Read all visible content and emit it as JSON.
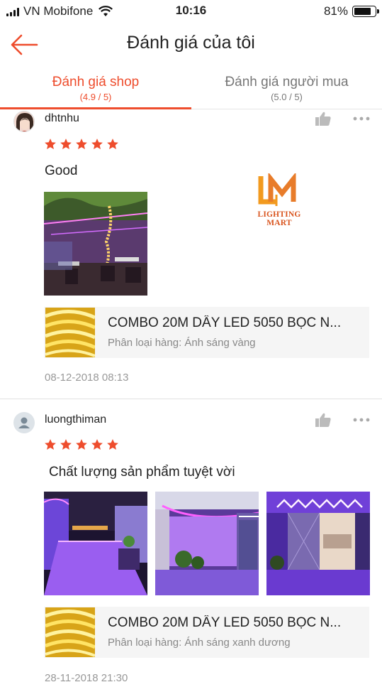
{
  "status_bar": {
    "carrier": "VN Mobifone",
    "time": "10:16",
    "battery": "81%",
    "battery_level": 0.81
  },
  "header": {
    "title": "Đánh giá của tôi",
    "back_icon": "arrow-left-icon"
  },
  "tabs": [
    {
      "label": "Đánh giá shop",
      "rating": "(4.9 / 5)",
      "active": true
    },
    {
      "label": "Đánh giá người mua",
      "rating": "(5.0 / 5)",
      "active": false
    }
  ],
  "colors": {
    "accent": "#ee4d2d",
    "star": "#ee4d2d",
    "muted": "#999999",
    "card_bg": "#f5f5f5"
  },
  "reviews": [
    {
      "username": "dhtnhu",
      "stars": 5,
      "comment": "Good",
      "watermark_logo_text": "LIGHTING MART",
      "product": {
        "name": "COMBO 20M DÂY LED 5050 BỌC N...",
        "variant": "Phân loại hàng: Ánh sáng vàng"
      },
      "date": "08-12-2018 08:13"
    },
    {
      "username": "luongthiman",
      "stars": 5,
      "comment": "Chất lượng sản phẩm tuyệt vời",
      "product": {
        "name": "COMBO 20M DÂY LED 5050 BỌC N...",
        "variant": "Phân loại hàng: Ánh sáng xanh dương"
      },
      "date": "28-11-2018 21:30"
    }
  ]
}
